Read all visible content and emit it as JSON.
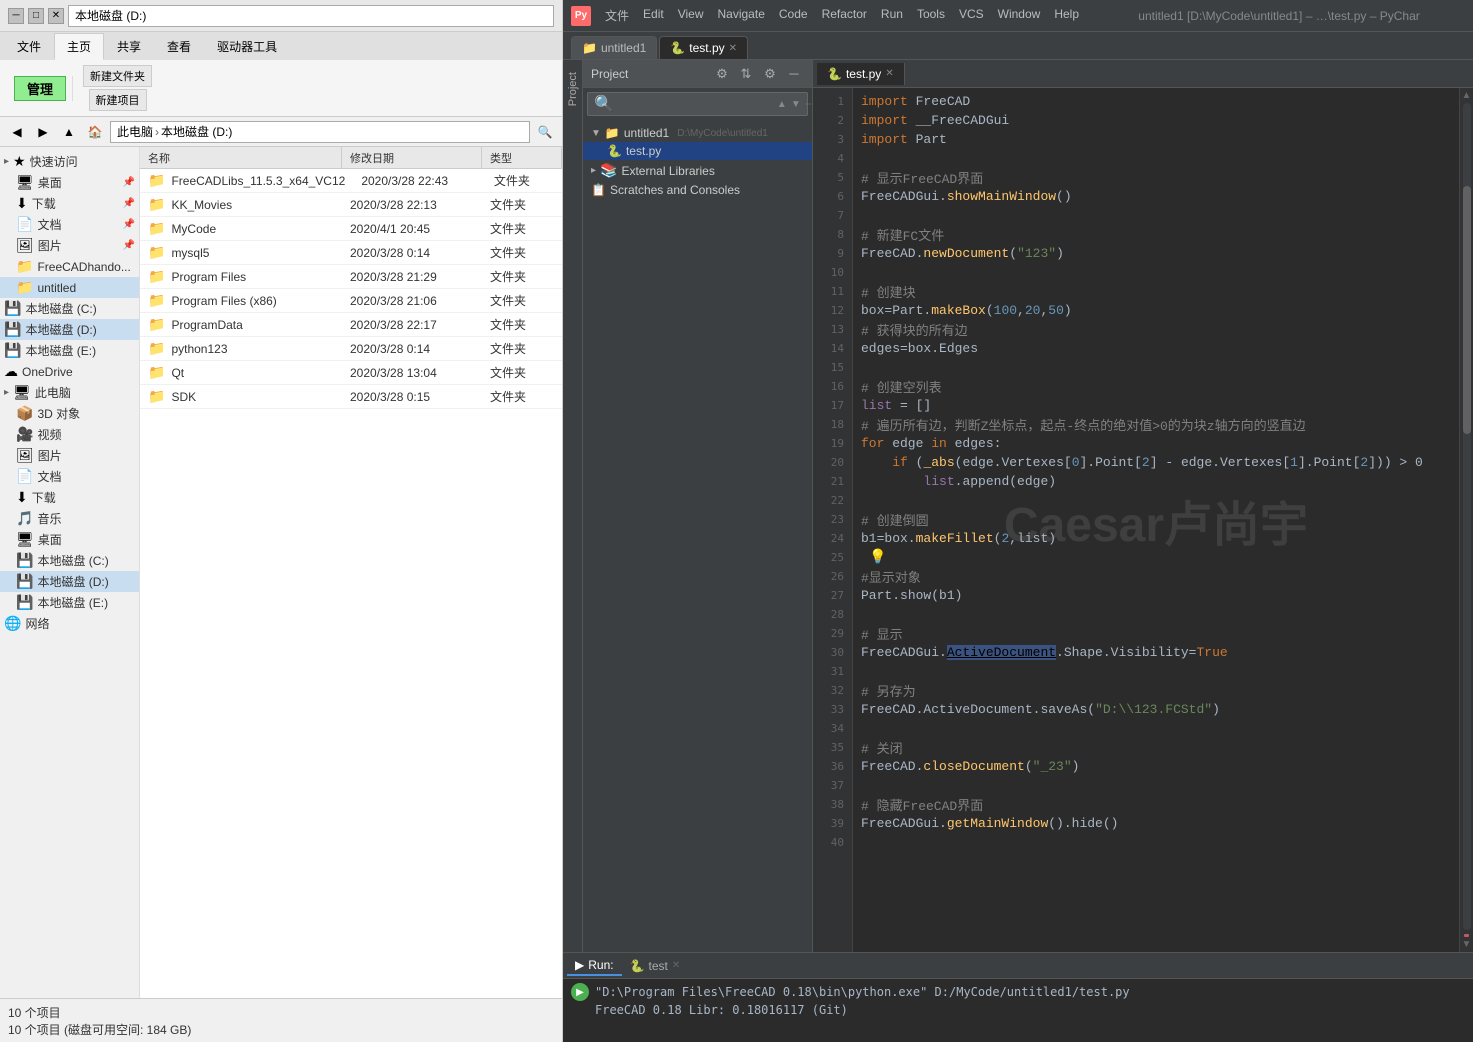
{
  "fileExplorer": {
    "title": "本地磁盘 (D:)",
    "ribbon": {
      "tabs": [
        "文件",
        "主页",
        "共享",
        "查看"
      ],
      "activeTab": "主页",
      "driveTab": "驱动器工具"
    },
    "toolbar": {
      "back": "◀",
      "forward": "▶",
      "up": "▲",
      "address": [
        "此电脑",
        "本地磁盘 (D:)"
      ]
    },
    "sidebar": {
      "items": [
        {
          "label": "快速访问",
          "icon": "★",
          "indent": 0,
          "expandable": true
        },
        {
          "label": "桌面",
          "icon": "🖥",
          "indent": 1
        },
        {
          "label": "下载",
          "icon": "⬇",
          "indent": 1
        },
        {
          "label": "文档",
          "icon": "📄",
          "indent": 1
        },
        {
          "label": "图片",
          "icon": "🖼",
          "indent": 1
        },
        {
          "label": "FreeCADhando...",
          "icon": "📁",
          "indent": 1
        },
        {
          "label": "untitled",
          "icon": "📁",
          "indent": 1
        },
        {
          "label": "本地磁盘 (C:)",
          "icon": "💾",
          "indent": 0
        },
        {
          "label": "本地磁盘 (D:)",
          "icon": "💾",
          "indent": 0,
          "selected": true
        },
        {
          "label": "本地磁盘 (E:)",
          "icon": "💾",
          "indent": 0
        },
        {
          "label": "OneDrive",
          "icon": "☁",
          "indent": 0
        },
        {
          "label": "此电脑",
          "icon": "🖥",
          "indent": 0,
          "expandable": true
        },
        {
          "label": "3D 对象",
          "icon": "📦",
          "indent": 1
        },
        {
          "label": "视频",
          "icon": "🎥",
          "indent": 1
        },
        {
          "label": "图片",
          "icon": "🖼",
          "indent": 1
        },
        {
          "label": "文档",
          "icon": "📄",
          "indent": 1
        },
        {
          "label": "下载",
          "icon": "⬇",
          "indent": 1
        },
        {
          "label": "音乐",
          "icon": "🎵",
          "indent": 1
        },
        {
          "label": "桌面",
          "icon": "🖥",
          "indent": 1
        },
        {
          "label": "本地磁盘 (C:)",
          "icon": "💾",
          "indent": 1
        },
        {
          "label": "本地磁盘 (D:)",
          "icon": "💾",
          "indent": 1,
          "selected": true
        },
        {
          "label": "本地磁盘 (E:)",
          "icon": "💾",
          "indent": 1
        },
        {
          "label": "网络",
          "icon": "🌐",
          "indent": 0
        }
      ]
    },
    "columns": [
      "名称",
      "修改日期",
      "类型"
    ],
    "files": [
      {
        "name": "FreeCADLibs_11.5.3_x64_VC12",
        "date": "2020/3/28 22:43",
        "type": "文件夹"
      },
      {
        "name": "KK_Movies",
        "date": "2020/3/28 22:13",
        "type": "文件夹"
      },
      {
        "name": "MyCode",
        "date": "2020/4/1 20:45",
        "type": "文件夹"
      },
      {
        "name": "mysql5",
        "date": "2020/3/28 0:14",
        "type": "文件夹"
      },
      {
        "name": "Program Files",
        "date": "2020/3/28 21:29",
        "type": "文件夹"
      },
      {
        "name": "Program Files (x86)",
        "date": "2020/3/28 21:06",
        "type": "文件夹"
      },
      {
        "name": "ProgramData",
        "date": "2020/3/28 22:17",
        "type": "文件夹"
      },
      {
        "name": "python123",
        "date": "2020/3/28 0:14",
        "type": "文件夹"
      },
      {
        "name": "Qt",
        "date": "2020/3/28 13:04",
        "type": "文件夹"
      },
      {
        "name": "SDK",
        "date": "2020/3/28 0:15",
        "type": "文件夹"
      }
    ],
    "statusbar": {
      "count": "10 个项目",
      "diskInfo": "10 个项目 (磁盘可用空间: 184 GB)"
    }
  },
  "ide": {
    "titlebar": {
      "logo": "Py",
      "title": "untitled1 [D:\\MyCode\\untitled1] – …\\test.py – PyChar",
      "menu": [
        "文件",
        "Edit",
        "View",
        "Navigate",
        "Code",
        "Refactor",
        "Run",
        "Tools",
        "VCS",
        "Window",
        "Help"
      ]
    },
    "tabs": [
      {
        "label": "untitled1",
        "icon": "📁",
        "active": false
      },
      {
        "label": "test.py",
        "icon": "🐍",
        "active": true
      }
    ],
    "project": {
      "header": "Project",
      "search_placeholder": "",
      "tree": [
        {
          "label": "untitled1",
          "path": "D:\\MyCode\\untitled1",
          "level": 0,
          "expanded": true,
          "type": "folder"
        },
        {
          "label": "test.py",
          "level": 1,
          "type": "file",
          "selected": true
        },
        {
          "label": "External Libraries",
          "level": 0,
          "expanded": false,
          "type": "folder"
        },
        {
          "label": "Scratches and Consoles",
          "level": 0,
          "type": "folder"
        }
      ]
    },
    "editor": {
      "activeFile": "test.py",
      "lines": [
        {
          "num": 1,
          "tokens": [
            {
              "text": "import ",
              "cls": "c-keyword"
            },
            {
              "text": "FreeCAD",
              "cls": "c-class"
            }
          ]
        },
        {
          "num": 2,
          "tokens": [
            {
              "text": "import",
              "cls": "c-keyword"
            },
            {
              "text": " __FreeCADGui",
              "cls": "c-class"
            }
          ]
        },
        {
          "num": 3,
          "tokens": [
            {
              "text": "import ",
              "cls": "c-keyword"
            },
            {
              "text": "Part",
              "cls": "c-class"
            }
          ]
        },
        {
          "num": 4,
          "tokens": []
        },
        {
          "num": 5,
          "tokens": [
            {
              "text": "# 显示FreeCAD界面",
              "cls": "c-comment"
            }
          ]
        },
        {
          "num": 6,
          "tokens": [
            {
              "text": "FreeCADGui",
              "cls": "c-class"
            },
            {
              "text": ".",
              "cls": "c-normal"
            },
            {
              "text": "showMainWindow",
              "cls": "c-method"
            },
            {
              "text": "()",
              "cls": "c-normal"
            }
          ]
        },
        {
          "num": 7,
          "tokens": []
        },
        {
          "num": 8,
          "tokens": [
            {
              "text": "# 新建FC文件",
              "cls": "c-comment"
            }
          ]
        },
        {
          "num": 9,
          "tokens": [
            {
              "text": "FreeCAD",
              "cls": "c-class"
            },
            {
              "text": ".",
              "cls": "c-normal"
            },
            {
              "text": "newDocument",
              "cls": "c-method"
            },
            {
              "text": "(",
              "cls": "c-normal"
            },
            {
              "text": "\"123\"",
              "cls": "c-string"
            },
            {
              "text": ")",
              "cls": "c-normal"
            }
          ]
        },
        {
          "num": 10,
          "tokens": []
        },
        {
          "num": 11,
          "tokens": [
            {
              "text": "# 创建块",
              "cls": "c-comment"
            }
          ]
        },
        {
          "num": 12,
          "tokens": [
            {
              "text": "box=Part.",
              "cls": "c-normal"
            },
            {
              "text": "makeBox",
              "cls": "c-method"
            },
            {
              "text": "(",
              "cls": "c-normal"
            },
            {
              "text": "100",
              "cls": "c-number"
            },
            {
              "text": ",",
              "cls": "c-normal"
            },
            {
              "text": "20",
              "cls": "c-number"
            },
            {
              "text": ",",
              "cls": "c-normal"
            },
            {
              "text": "50",
              "cls": "c-number"
            },
            {
              "text": ")",
              "cls": "c-normal"
            }
          ]
        },
        {
          "num": 13,
          "tokens": [
            {
              "text": "# 获得块的所有边",
              "cls": "c-comment"
            }
          ]
        },
        {
          "num": 14,
          "tokens": [
            {
              "text": "edges=box.Edges",
              "cls": "c-normal"
            }
          ]
        },
        {
          "num": 15,
          "tokens": []
        },
        {
          "num": 16,
          "tokens": [
            {
              "text": "# 创建空列表",
              "cls": "c-comment"
            }
          ]
        },
        {
          "num": 17,
          "tokens": [
            {
              "text": "list",
              "cls": "c-var"
            },
            {
              "text": " = []",
              "cls": "c-normal"
            }
          ]
        },
        {
          "num": 18,
          "tokens": [
            {
              "text": "# 遍历所有边，判断Z坐标点，起点-终点的绝对值>0的为块z轴方向的竖直边",
              "cls": "c-comment"
            }
          ]
        },
        {
          "num": 19,
          "tokens": [
            {
              "text": "for",
              "cls": "c-keyword"
            },
            {
              "text": " edge ",
              "cls": "c-normal"
            },
            {
              "text": "in",
              "cls": "c-keyword"
            },
            {
              "text": " edges:",
              "cls": "c-normal"
            }
          ]
        },
        {
          "num": 20,
          "tokens": [
            {
              "text": "    ",
              "cls": "c-normal"
            },
            {
              "text": "if",
              "cls": "c-keyword"
            },
            {
              "text": " (",
              "cls": "c-normal"
            },
            {
              "text": "_abs",
              "cls": "c-func"
            },
            {
              "text": "(edge.Vertexes[",
              "cls": "c-normal"
            },
            {
              "text": "0",
              "cls": "c-number"
            },
            {
              "text": "].Point[",
              "cls": "c-normal"
            },
            {
              "text": "2",
              "cls": "c-number"
            },
            {
              "text": "] - edge.Vertexes[",
              "cls": "c-normal"
            },
            {
              "text": "1",
              "cls": "c-number"
            },
            {
              "text": "].Point[",
              "cls": "c-normal"
            },
            {
              "text": "2",
              "cls": "c-number"
            },
            {
              "text": "])) > 0",
              "cls": "c-normal"
            }
          ]
        },
        {
          "num": 21,
          "tokens": [
            {
              "text": "        ",
              "cls": "c-normal"
            },
            {
              "text": "list",
              "cls": "c-var"
            },
            {
              "text": ".append(edge)",
              "cls": "c-normal"
            }
          ]
        },
        {
          "num": 22,
          "tokens": []
        },
        {
          "num": 23,
          "tokens": [
            {
              "text": "# 创建倒圆",
              "cls": "c-comment"
            }
          ]
        },
        {
          "num": 24,
          "tokens": [
            {
              "text": "b1=box.",
              "cls": "c-normal"
            },
            {
              "text": "makeFillet",
              "cls": "c-method"
            },
            {
              "text": "(",
              "cls": "c-normal"
            },
            {
              "text": "2",
              "cls": "c-number"
            },
            {
              "text": ",list)",
              "cls": "c-normal"
            }
          ]
        },
        {
          "num": 25,
          "tokens": []
        },
        {
          "num": 26,
          "tokens": [
            {
              "text": "#显示对象",
              "cls": "c-comment"
            }
          ]
        },
        {
          "num": 27,
          "tokens": [
            {
              "text": "Part",
              "cls": "c-class"
            },
            {
              "text": ".show(b1)",
              "cls": "c-normal"
            }
          ]
        },
        {
          "num": 28,
          "tokens": []
        },
        {
          "num": 29,
          "tokens": [
            {
              "text": "# 显示",
              "cls": "c-comment"
            }
          ]
        },
        {
          "num": 30,
          "tokens": [
            {
              "text": "FreeCADGui",
              "cls": "c-class"
            },
            {
              "text": ".",
              "cls": "c-normal"
            },
            {
              "text": "ActiveDocument",
              "cls": "c-highlight"
            },
            {
              "text": ".Shape.Visibility=",
              "cls": "c-normal"
            },
            {
              "text": "True",
              "cls": "c-true"
            }
          ]
        },
        {
          "num": 31,
          "tokens": []
        },
        {
          "num": 32,
          "tokens": [
            {
              "text": "# 另存为",
              "cls": "c-comment"
            }
          ]
        },
        {
          "num": 33,
          "tokens": [
            {
              "text": "FreeCAD",
              "cls": "c-class"
            },
            {
              "text": ".",
              "cls": "c-normal"
            },
            {
              "text": "ActiveDocument",
              "cls": "c-normal"
            },
            {
              "text": ".saveAs(",
              "cls": "c-normal"
            },
            {
              "text": "\"D:\\\\123.FCStd\"",
              "cls": "c-string"
            },
            {
              "text": ")",
              "cls": "c-normal"
            }
          ]
        },
        {
          "num": 34,
          "tokens": []
        },
        {
          "num": 35,
          "tokens": [
            {
              "text": "# 关闭",
              "cls": "c-comment"
            }
          ]
        },
        {
          "num": 36,
          "tokens": [
            {
              "text": "FreeCAD",
              "cls": "c-class"
            },
            {
              "text": ".",
              "cls": "c-normal"
            },
            {
              "text": "closeDocument",
              "cls": "c-method"
            },
            {
              "text": "(",
              "cls": "c-normal"
            },
            {
              "text": "\"_23\"",
              "cls": "c-string"
            },
            {
              "text": ")",
              "cls": "c-normal"
            }
          ]
        },
        {
          "num": 37,
          "tokens": []
        },
        {
          "num": 38,
          "tokens": [
            {
              "text": "# 隐藏FreeCAD界面",
              "cls": "c-comment"
            }
          ]
        },
        {
          "num": 39,
          "tokens": [
            {
              "text": "FreeCADGui",
              "cls": "c-class"
            },
            {
              "text": ".",
              "cls": "c-normal"
            },
            {
              "text": "getMainWindow",
              "cls": "c-method"
            },
            {
              "text": "().hide()",
              "cls": "c-normal"
            }
          ]
        },
        {
          "num": 40,
          "tokens": []
        }
      ]
    },
    "run": {
      "tabs": [
        "Run:",
        "test"
      ],
      "outputLine": "\"D:\\Program Files\\FreeCAD 0.18\\bin\\python.exe\" D:/MyCode/untitled1/test.py",
      "outputLine2": "FreeCAD 0.18  Libr: 0.18016117 (Git)"
    },
    "watermark": "Caesar卢尚宇"
  }
}
